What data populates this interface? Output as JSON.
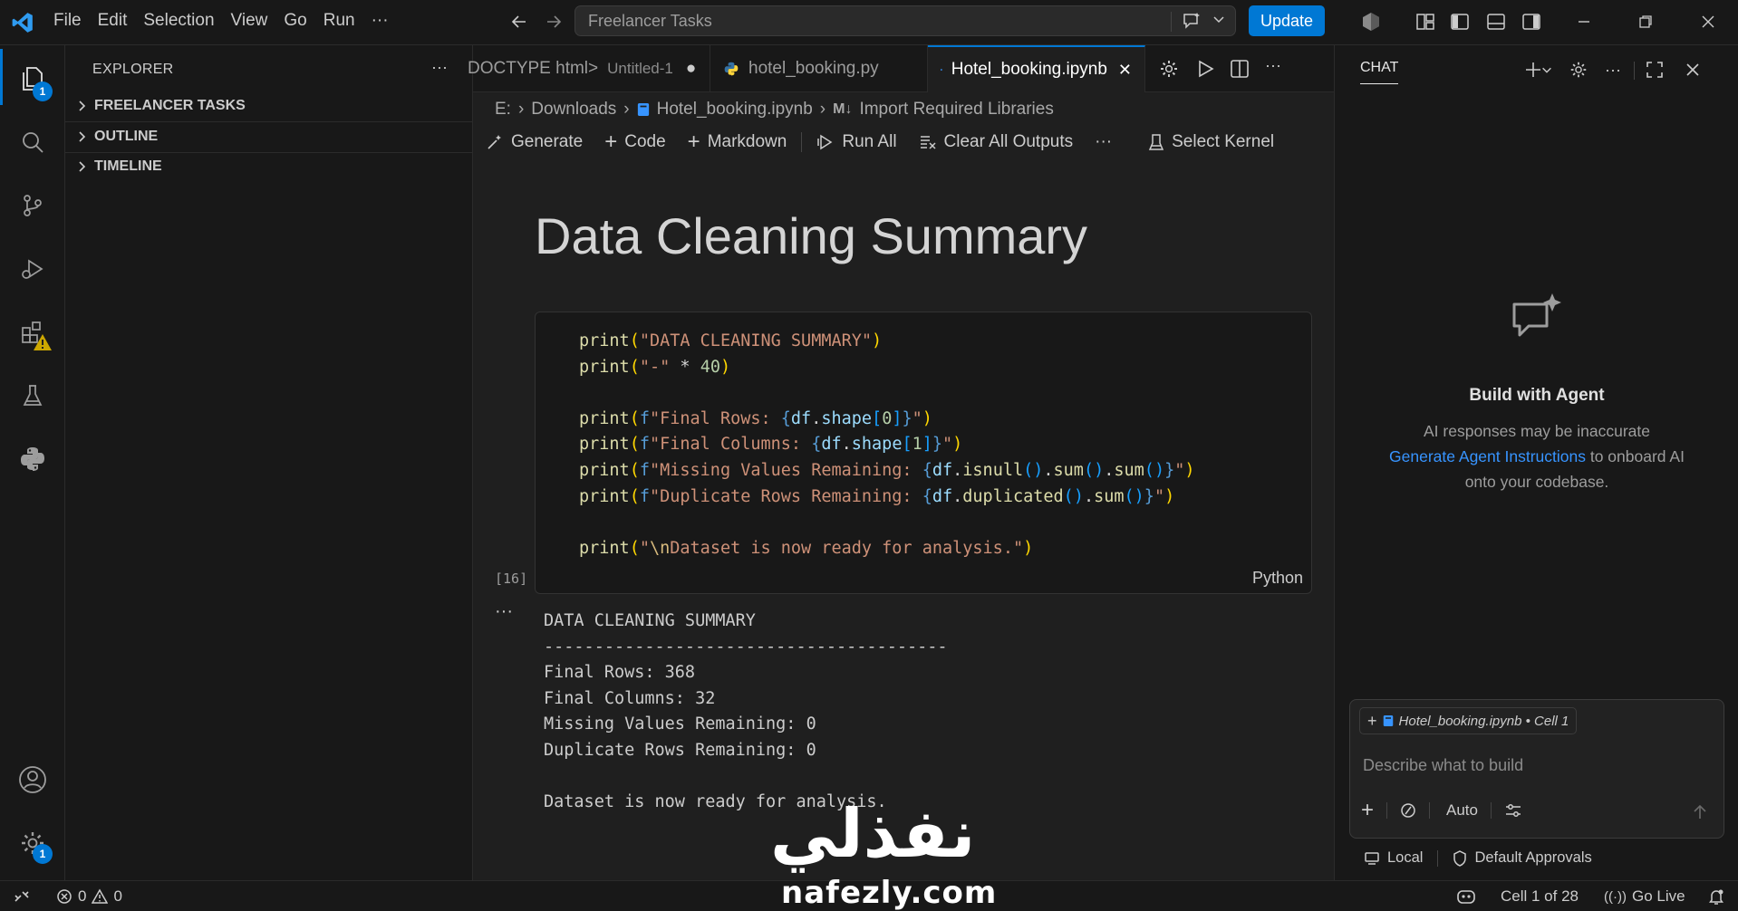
{
  "menu": [
    "File",
    "Edit",
    "Selection",
    "View",
    "Go",
    "Run",
    "···"
  ],
  "command_center": {
    "text": "Freelancer Tasks"
  },
  "update_button": "Update",
  "activity": {
    "explorer_badge": "1",
    "settings_badge": "1"
  },
  "explorer": {
    "title": "EXPLORER",
    "more": "···",
    "sections": [
      "FREELANCER TASKS",
      "OUTLINE",
      "TIMELINE"
    ]
  },
  "tabs": [
    {
      "label": "DOCTYPE html>",
      "sub": "Untitled-1",
      "dirty": "●"
    },
    {
      "label": "hotel_booking.py"
    },
    {
      "label": "Hotel_booking.ipynb",
      "close": "✕"
    }
  ],
  "breadcrumb": [
    "E:",
    "Downloads",
    "Hotel_booking.ipynb",
    "Import Required Libraries"
  ],
  "nb_toolbar": {
    "generate": "Generate",
    "code": "Code",
    "markdown": "Markdown",
    "run_all": "Run All",
    "clear": "Clear All Outputs",
    "more": "···",
    "kernel": "Select Kernel"
  },
  "notebook": {
    "heading": "Data Cleaning Summary",
    "code_lines": [
      "print(\"DATA CLEANING SUMMARY\")",
      "print(\"-\" * 40)",
      "",
      "print(f\"Final Rows: {df.shape[0]}\")",
      "print(f\"Final Columns: {df.shape[1]}\")",
      "print(f\"Missing Values Remaining: {df.isnull().sum().sum()}\")",
      "print(f\"Duplicate Rows Remaining: {df.duplicated().sum()}\")",
      "",
      "print(\"\\nDataset is now ready for analysis.\")"
    ],
    "exec_count": "[16]",
    "language": "Python",
    "output_lines": [
      "DATA CLEANING SUMMARY",
      "----------------------------------------",
      "Final Rows: 368",
      "Final Columns: 32",
      "Missing Values Remaining: 0",
      "Duplicate Rows Remaining: 0",
      "",
      "Dataset is now ready for analysis."
    ]
  },
  "chat": {
    "tab": "CHAT",
    "title": "Build with Agent",
    "sub1": "AI responses may be inaccurate",
    "link": "Generate Agent Instructions",
    "sub2": " to onboard AI",
    "sub3": "onto your codebase.",
    "context_chip": "Hotel_booking.ipynb • Cell 1",
    "placeholder": "Describe what to build",
    "mode": "Auto",
    "footer_local": "Local",
    "footer_approvals": "Default Approvals"
  },
  "status": {
    "errors": "0",
    "warnings": "0",
    "cell": "Cell 1 of 28",
    "golive": "Go Live"
  },
  "watermark": {
    "arabic": "نفذلي",
    "latin": "nafezly.com"
  },
  "colors": {
    "accent": "#0078d4",
    "bg": "#1f1f1f",
    "sidebar": "#181818"
  }
}
